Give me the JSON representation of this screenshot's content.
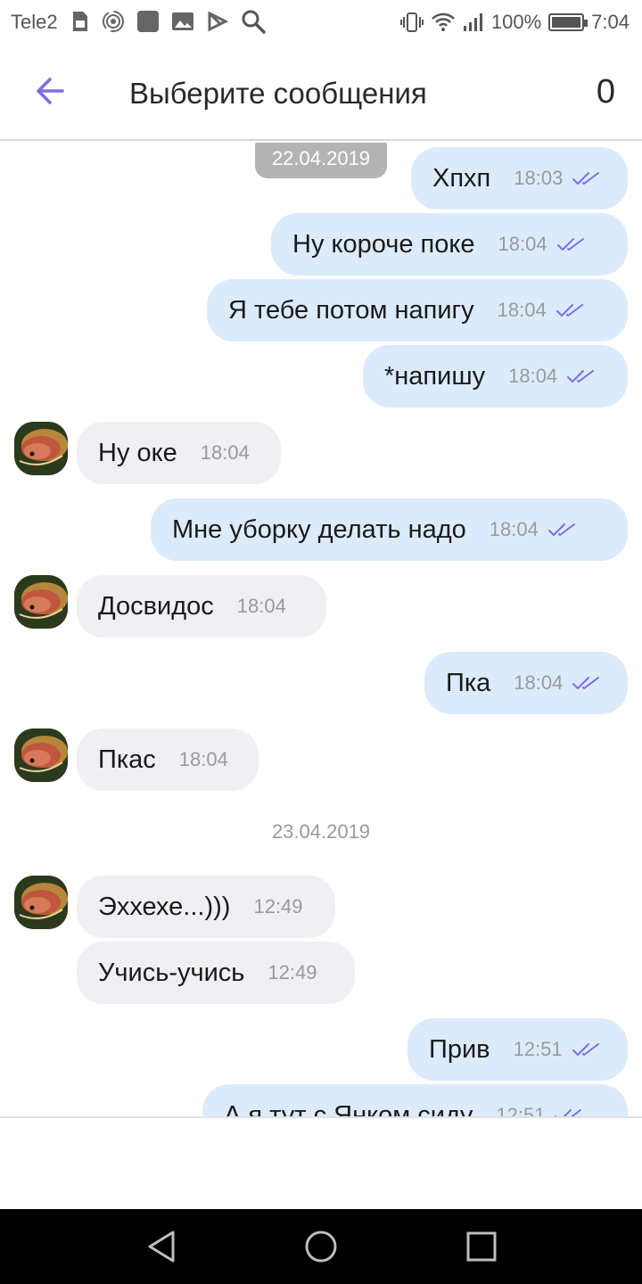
{
  "status_bar": {
    "carrier": "Tele2",
    "battery": "100%",
    "battery_level": 1.0,
    "time": "7:04",
    "icons_left": [
      "sim-card-icon",
      "hotspot-icon",
      "app-square-icon",
      "gallery-icon",
      "play-store-icon",
      "search-icon"
    ],
    "icons_right": [
      "vibrate-icon",
      "wifi-icon",
      "signal-icon",
      "battery-icon"
    ]
  },
  "header": {
    "title": "Выберите сообщения",
    "count": "0",
    "back_icon": "arrow-left-icon"
  },
  "colors": {
    "accent": "#7b6ee6",
    "outgoing_bubble": "#dcebfc",
    "incoming_bubble": "#f0eff3",
    "date_pill": "#b3b3b3"
  },
  "dates": {
    "first": "22.04.2019",
    "second": "23.04.2019"
  },
  "messages": [
    {
      "dir": "out",
      "text": "Хпхп",
      "time": "18:03"
    },
    {
      "dir": "out",
      "text": "Ну короче поке",
      "time": "18:04"
    },
    {
      "dir": "out",
      "text": "Я тебе потом напигу",
      "time": "18:04"
    },
    {
      "dir": "out",
      "text": "*напишу",
      "time": "18:04"
    },
    {
      "dir": "in",
      "text": "Ну оке",
      "time": "18:04"
    },
    {
      "dir": "out",
      "text": "Мне уборку делать надо",
      "time": "18:04"
    },
    {
      "dir": "in",
      "text": "Досвидос",
      "time": "18:04"
    },
    {
      "dir": "out",
      "text": "Пка",
      "time": "18:04"
    },
    {
      "dir": "in",
      "text": "Пкас",
      "time": "18:04"
    },
    {
      "dir": "in",
      "text": "Эххехе...)))",
      "time": "12:49"
    },
    {
      "dir": "in",
      "text": "Учись-учись",
      "time": "12:49"
    },
    {
      "dir": "out",
      "text": "Прив",
      "time": "12:51"
    },
    {
      "dir": "out",
      "text": "А я тут с Янком сиду",
      "time": "12:51"
    }
  ],
  "nav_bar": [
    "back-triangle-icon",
    "home-circle-icon",
    "recents-square-icon"
  ]
}
